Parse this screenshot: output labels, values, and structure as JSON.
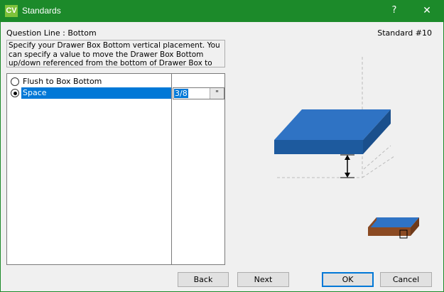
{
  "window": {
    "app_icon_text": "CV",
    "title": "Standards",
    "help_label": "?",
    "close_label": "✕"
  },
  "header": {
    "question_line": "Question Line : Bottom",
    "standard_number": "Standard #10"
  },
  "description": "Specify your Drawer Box Bottom vertical placement. You can specify a value to move the Drawer Box Bottom up/down referenced from the bottom of Drawer Box to the bottom of",
  "options": [
    {
      "label": "Flush to Box Bottom",
      "selected": false
    },
    {
      "label": "Space",
      "selected": true
    }
  ],
  "space_value": {
    "value": "3/8",
    "unit": "\""
  },
  "buttons": {
    "back": "Back",
    "next": "Next",
    "ok": "OK",
    "cancel": "Cancel"
  },
  "colors": {
    "titlebar": "#1c8a2a",
    "selection": "#0078d7",
    "box_top": "#2f73c4",
    "box_side": "#1d5a9e",
    "thumb_wood": "#8b4a22"
  }
}
